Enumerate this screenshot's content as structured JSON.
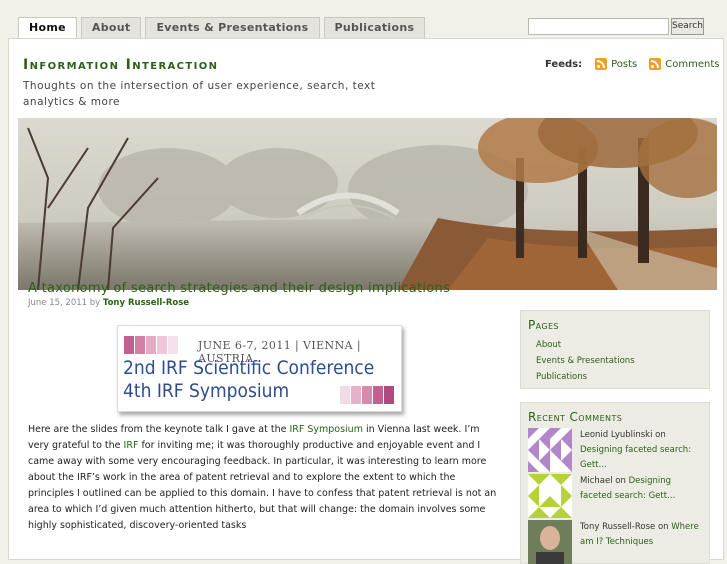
{
  "nav": {
    "tabs": [
      {
        "label": "Home",
        "active": true
      },
      {
        "label": "About",
        "active": false
      },
      {
        "label": "Events & Presentations",
        "active": false
      },
      {
        "label": "Publications",
        "active": false
      }
    ]
  },
  "search": {
    "placeholder": "",
    "button_label": "Search"
  },
  "site": {
    "title": "Information Interaction",
    "tagline": "Thoughts on the intersection of user experience, search, text analytics & more"
  },
  "feeds": {
    "label": "Feeds:",
    "posts": "Posts",
    "comments": "Comments",
    "icon": "rss-icon"
  },
  "header_image": {
    "alt": "misty-park-bridge-image"
  },
  "post": {
    "title": "A taxonomy of search strategies and their design implications",
    "date": "June 15, 2011",
    "by": "by",
    "author": "Tony Russell-Rose",
    "banner": {
      "line1": "JUNE 6-7, 2011 | VIENNA | AUSTRIA",
      "line2_ord": "2nd",
      "line2_text": " IRF Scientific Conference",
      "line3_ord": "4th",
      "line3_text": " IRF Symposium"
    },
    "body": {
      "p1_a": "Here are the slides from the keynote talk I gave at the ",
      "p1_link1": "IRF Symposium",
      "p1_b": " in Vienna last week. I’m very grateful to the ",
      "p1_link2": "IRF",
      "p1_c": " for inviting me; it was thoroughly productive and enjoyable event and I came away with some very encouraging feedback. In particular, it was interesting to learn more about the IRF’s work in the area of patent retrieval and to explore the extent to which the principles I outlined can be applied to this domain. I have to confess that patent retrieval is not an area to which I’d given much attention hitherto, but that will change: the domain involves some highly sophisticated, discovery-oriented tasks"
    }
  },
  "sidebar": {
    "pages": {
      "title": "Pages",
      "items": [
        "About",
        "Events & Presentations",
        "Publications"
      ]
    },
    "recent_comments": {
      "title": "Recent Comments",
      "items": [
        {
          "author": "Leonid Lyublinski",
          "on": "on",
          "link": "Designing faceted search: Gett…"
        },
        {
          "author": "Michael",
          "on": "on",
          "link": "Designing faceted search: Gett…"
        },
        {
          "author": "Tony Russell-Rose",
          "on": "on",
          "link": "Where am I? Techniques"
        }
      ]
    }
  },
  "colors": {
    "accent": "#2b6016",
    "rss": "#f39c27",
    "banner_text": "#2d4d8f"
  }
}
